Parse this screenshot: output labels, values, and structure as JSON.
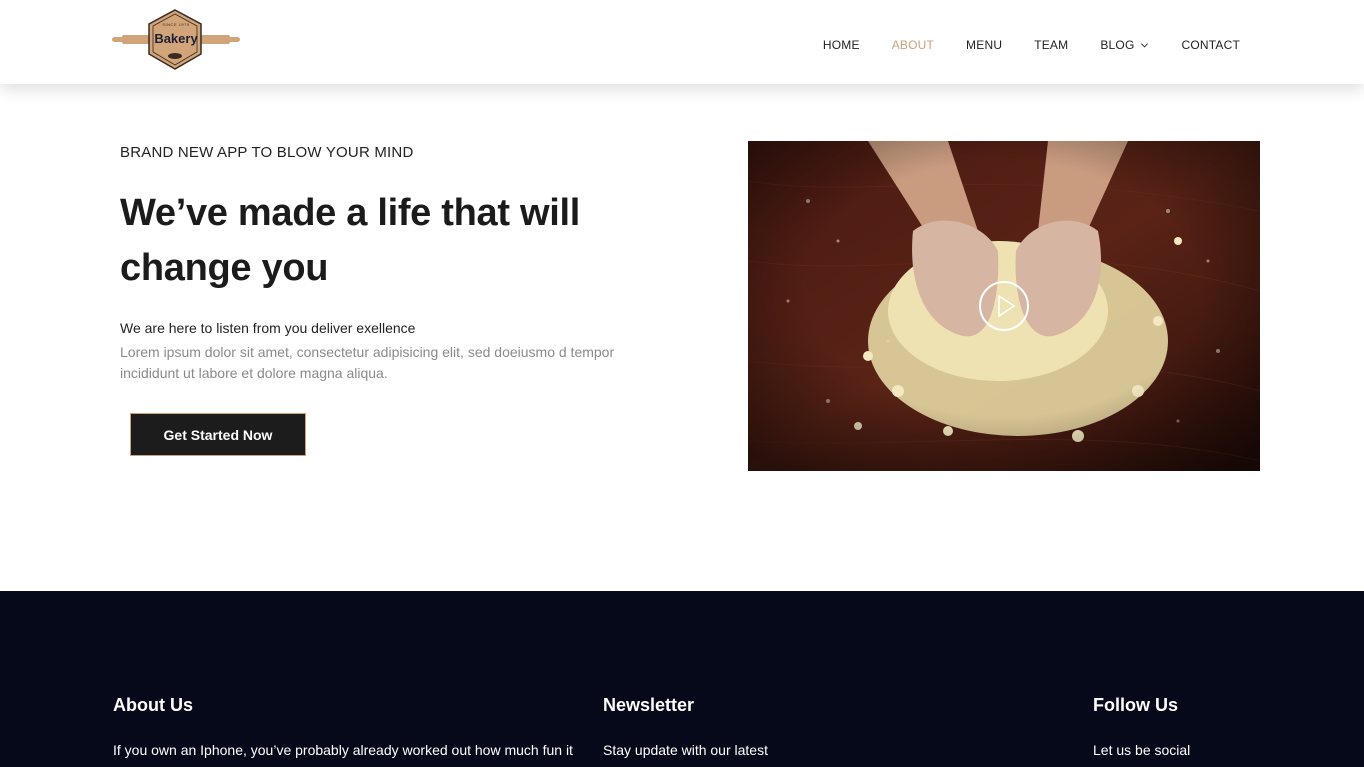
{
  "brand": {
    "logo_text": "Bakery",
    "logo_since": "SINCE 1979",
    "colors": {
      "accent": "#c9a27c",
      "dark": "#1c1c1c",
      "footer_bg": "#060919"
    }
  },
  "nav": {
    "items": [
      {
        "label": "HOME",
        "active": false
      },
      {
        "label": "ABOUT",
        "active": true
      },
      {
        "label": "MENU",
        "active": false
      },
      {
        "label": "TEAM",
        "active": false
      },
      {
        "label": "BLOG",
        "active": false,
        "dropdown": true
      },
      {
        "label": "CONTACT",
        "active": false
      }
    ],
    "dropdown_icon": "chevron-down-icon"
  },
  "hero": {
    "eyebrow": "BRAND NEW APP TO BLOW YOUR MIND",
    "headline": "We’ve made a life that will change you",
    "subtitle": "We are here to listen from you deliver exellence",
    "body": "Lorem ipsum dolor sit amet, consectetur adipisicing elit, sed doeiusmo d tempor incididunt ut labore et dolore magna aliqua.",
    "cta_label": "Get Started Now",
    "video_icon": "play-icon"
  },
  "footer": {
    "about": {
      "title": "About Us",
      "text": "If you own an Iphone, you’ve probably already worked out how much fun it is to use it to watch movies, it has that"
    },
    "newsletter": {
      "title": "Newsletter",
      "text": "Stay update with our latest"
    },
    "follow": {
      "title": "Follow Us",
      "text": "Let us be social"
    }
  }
}
